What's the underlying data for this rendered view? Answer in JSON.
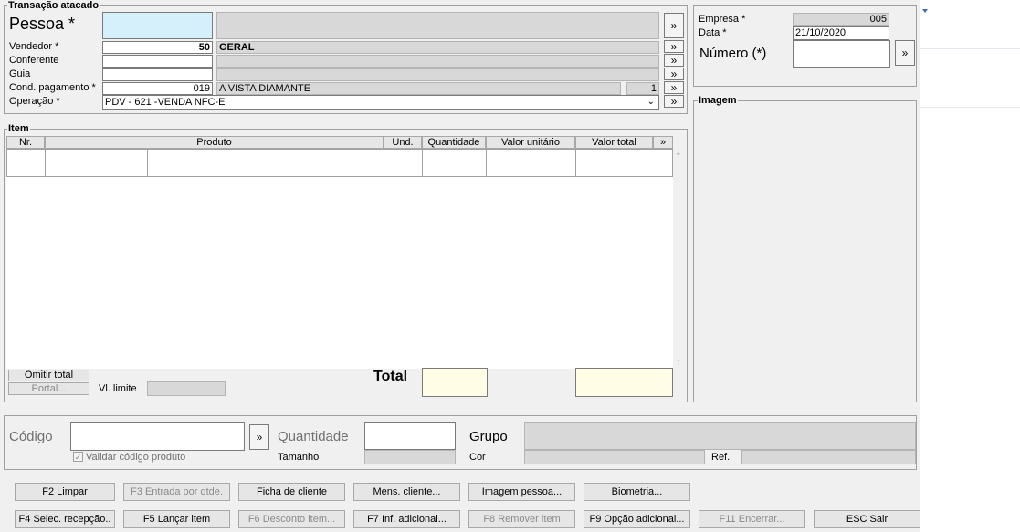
{
  "transacao": {
    "group_title": "Transação atacado",
    "pessoa_label": "Pessoa *",
    "pessoa_value": "",
    "pessoa_name": "",
    "vendedor_label": "Vendedor *",
    "vendedor_code": "50",
    "vendedor_name": "GERAL",
    "conferente_label": "Conferente",
    "guia_label": "Guia",
    "cond_label": "Cond. pagamento *",
    "cond_code": "019",
    "cond_name": "A VISTA DIAMANTE",
    "cond_parcelas": "1",
    "operacao_label": "Operação *",
    "operacao_value": "PDV - 621 -VENDA NFC-E",
    "more_symbol": "»"
  },
  "empresa": {
    "empresa_label": "Empresa *",
    "empresa_value": "005",
    "data_label": "Data *",
    "data_value": "21/10/2020",
    "numero_label": "Número (*)"
  },
  "imagem": {
    "group_title": "Imagem"
  },
  "item": {
    "group_title": "Item",
    "columns": [
      "Nr.",
      "Produto",
      "Und.",
      "Quantidade",
      "Valor unitário",
      "Valor total",
      "»"
    ],
    "omitir_total": "Omitir total",
    "portal": "Portal...",
    "vl_limite_label": "Vl. limite",
    "total_label": "Total"
  },
  "entrada": {
    "codigo_label": "Código",
    "quantidade_label": "Quantidade",
    "grupo_label": "Grupo",
    "validar_label": "Validar código produto",
    "tamanho_label": "Tamanho",
    "cor_label": "Cor",
    "ref_label": "Ref."
  },
  "buttons": {
    "row1": [
      "F2 Limpar",
      "F3 Entrada por qtde.",
      "Ficha de cliente",
      "Mens. cliente...",
      "Imagem pessoa...",
      "Biometria..."
    ],
    "row2": [
      "F4 Selec. recepção..",
      "F5 Lançar item",
      "F6 Desconto item...",
      "F7 Inf. adicional...",
      "F8 Remover item",
      "F9 Opção adicional...",
      "F11 Encerrar...",
      "ESC Sair"
    ]
  }
}
